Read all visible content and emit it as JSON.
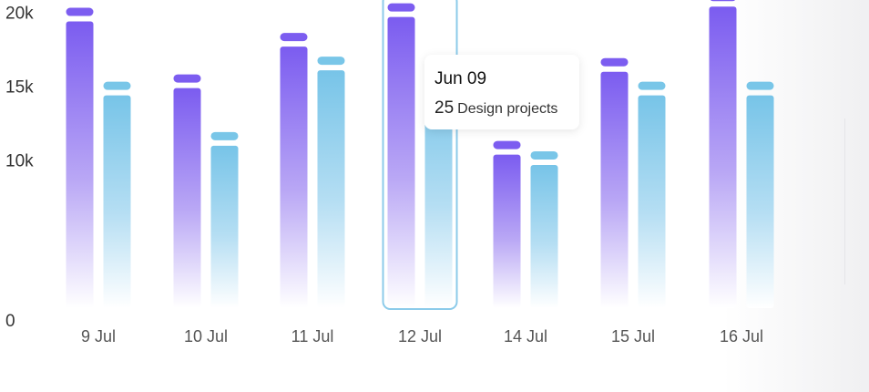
{
  "chart_data": {
    "type": "bar",
    "categories": [
      "9 Jul",
      "10 Jul",
      "11 Jul",
      "12 Jul",
      "14 Jul",
      "15 Jul",
      "16 Jul"
    ],
    "series": [
      {
        "values": [
          20300,
          15800,
          18600,
          20600,
          11300,
          16900,
          21300
        ]
      },
      {
        "values": [
          15300,
          11900,
          17000,
          16300,
          10600,
          15300,
          15300
        ]
      }
    ],
    "yticks": [
      "0",
      "10k",
      "15k",
      "20k"
    ],
    "ylim": [
      0,
      23000
    ],
    "grid": false,
    "highlighted_category": "12 Jul",
    "colors": {
      "series1": "#7c5df0",
      "series2": "#79c6e8",
      "highlight_border": "#8ccbea"
    }
  },
  "tooltip": {
    "title": "Jun 09",
    "value": "25",
    "label": "Design projects"
  }
}
